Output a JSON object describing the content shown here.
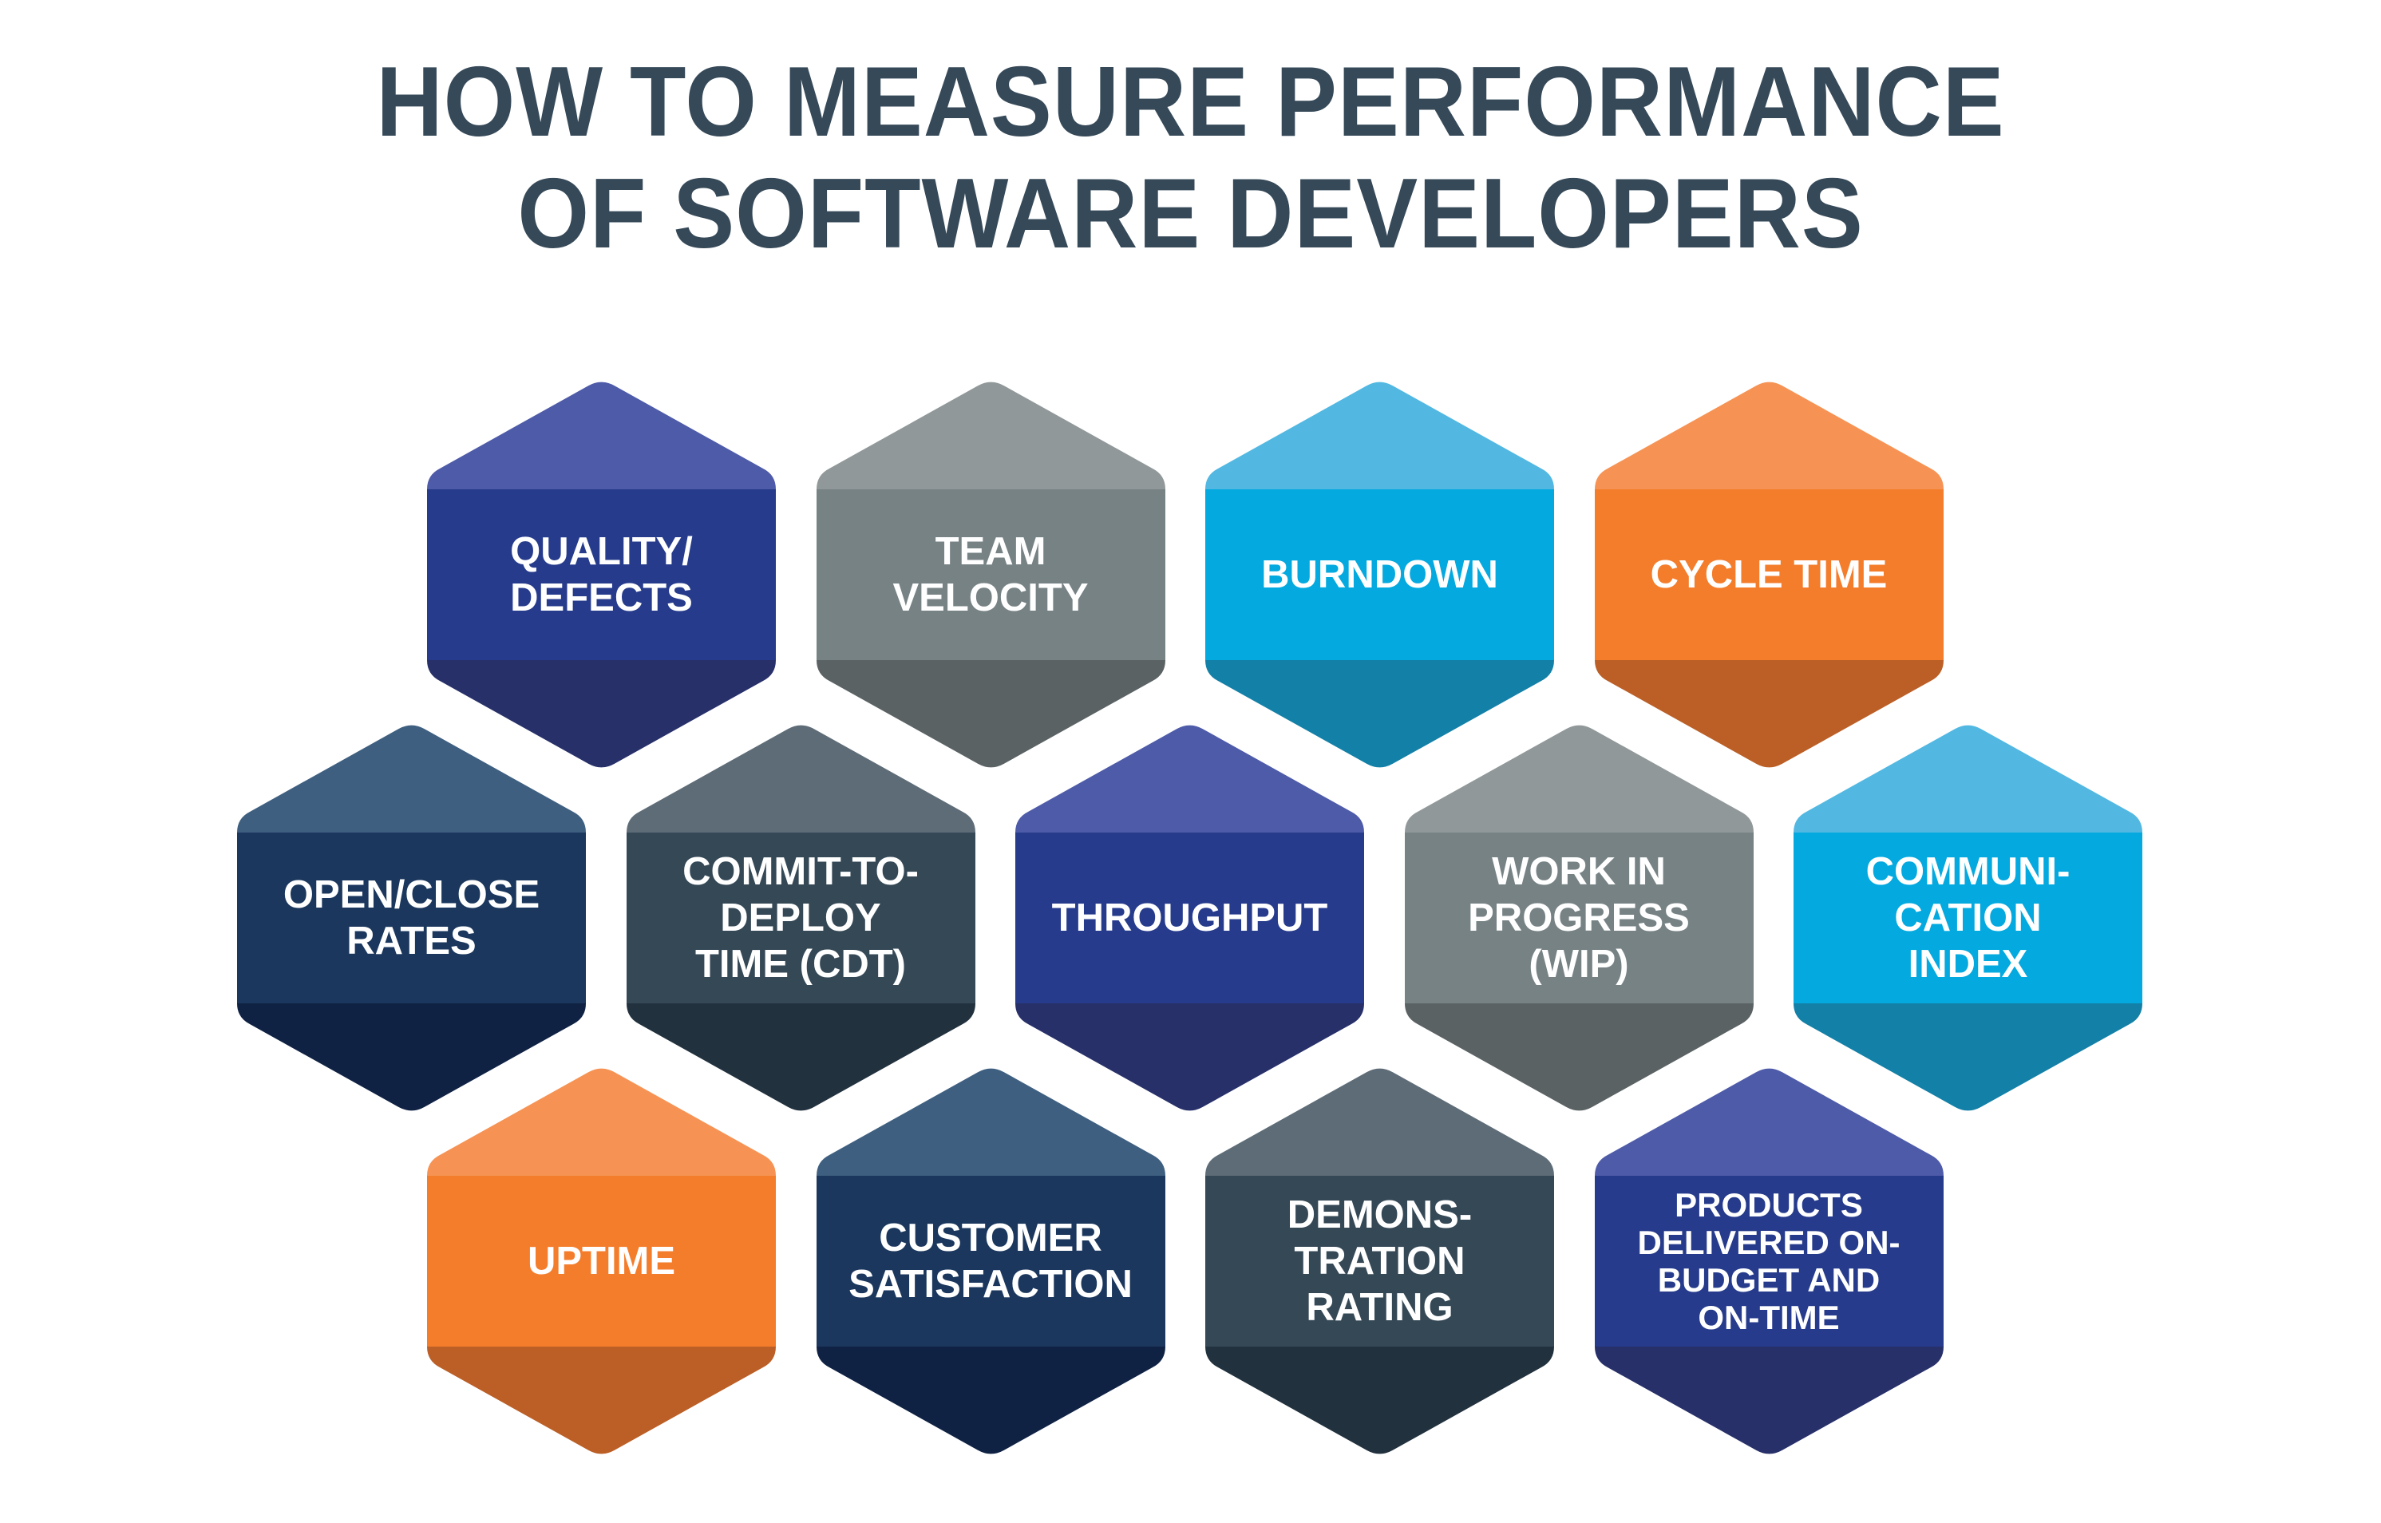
{
  "title": {
    "line1": "HOW TO MEASURE PERFORMANCE",
    "line2": "OF SOFTWARE DEVELOPERS"
  },
  "palettes": {
    "indigo": {
      "top": "#4E5BA8",
      "mid": "#263B8C",
      "bottom": "#273069"
    },
    "gray": {
      "top": "#919899",
      "mid": "#778285",
      "bottom": "#5A6264"
    },
    "sky": {
      "top": "#52B8E2",
      "mid": "#03A9DF",
      "bottom": "#1380A7"
    },
    "orange": {
      "top": "#F69354",
      "mid": "#F47D2C",
      "bottom": "#BB5F26"
    },
    "navy": {
      "top": "#3E5F80",
      "mid": "#1B375D",
      "bottom": "#0F2244"
    },
    "slate": {
      "top": "#5E6C77",
      "mid": "#354856",
      "bottom": "#22313E"
    }
  },
  "rows": [
    {
      "items": [
        {
          "lines": [
            "QUALITY/",
            "DEFECTS"
          ],
          "palette": "indigo"
        },
        {
          "lines": [
            "TEAM",
            "VELOCITY"
          ],
          "palette": "gray"
        },
        {
          "lines": [
            "BURNDOWN"
          ],
          "palette": "sky"
        },
        {
          "lines": [
            "CYCLE TIME"
          ],
          "palette": "orange"
        }
      ]
    },
    {
      "items": [
        {
          "lines": [
            "OPEN/CLOSE",
            "RATES"
          ],
          "palette": "navy"
        },
        {
          "lines": [
            "COMMIT-TO-",
            "DEPLOY",
            "TIME (CDT)"
          ],
          "palette": "slate"
        },
        {
          "lines": [
            "THROUGHPUT"
          ],
          "palette": "indigo"
        },
        {
          "lines": [
            "WORK IN",
            "PROGRESS",
            "(WIP)"
          ],
          "palette": "gray"
        },
        {
          "lines": [
            "COMMUNI-",
            "CATION",
            "INDEX"
          ],
          "palette": "sky"
        }
      ]
    },
    {
      "items": [
        {
          "lines": [
            "UPTIME"
          ],
          "palette": "orange"
        },
        {
          "lines": [
            "CUSTOMER",
            "SATISFACTION"
          ],
          "palette": "navy"
        },
        {
          "lines": [
            "DEMONS-",
            "TRATION",
            "RATING"
          ],
          "palette": "slate"
        },
        {
          "lines": [
            "PRODUCTS",
            "DELIVERED ON-",
            "BUDGET AND",
            "ON-TIME"
          ],
          "palette": "indigo"
        }
      ]
    }
  ]
}
